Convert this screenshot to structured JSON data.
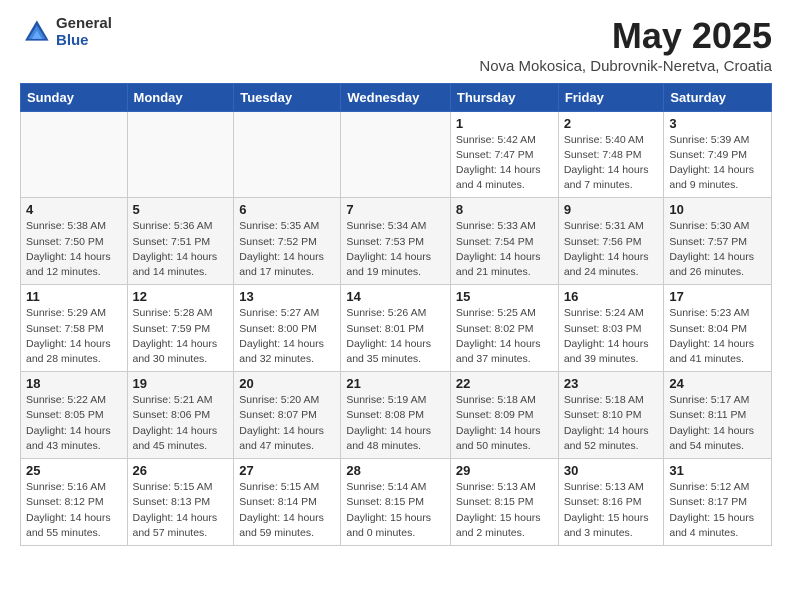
{
  "logo": {
    "general": "General",
    "blue": "Blue"
  },
  "title": "May 2025",
  "subtitle": "Nova Mokosica, Dubrovnik-Neretva, Croatia",
  "weekdays": [
    "Sunday",
    "Monday",
    "Tuesday",
    "Wednesday",
    "Thursday",
    "Friday",
    "Saturday"
  ],
  "weeks": [
    [
      {
        "day": "",
        "detail": ""
      },
      {
        "day": "",
        "detail": ""
      },
      {
        "day": "",
        "detail": ""
      },
      {
        "day": "",
        "detail": ""
      },
      {
        "day": "1",
        "detail": "Sunrise: 5:42 AM\nSunset: 7:47 PM\nDaylight: 14 hours\nand 4 minutes."
      },
      {
        "day": "2",
        "detail": "Sunrise: 5:40 AM\nSunset: 7:48 PM\nDaylight: 14 hours\nand 7 minutes."
      },
      {
        "day": "3",
        "detail": "Sunrise: 5:39 AM\nSunset: 7:49 PM\nDaylight: 14 hours\nand 9 minutes."
      }
    ],
    [
      {
        "day": "4",
        "detail": "Sunrise: 5:38 AM\nSunset: 7:50 PM\nDaylight: 14 hours\nand 12 minutes."
      },
      {
        "day": "5",
        "detail": "Sunrise: 5:36 AM\nSunset: 7:51 PM\nDaylight: 14 hours\nand 14 minutes."
      },
      {
        "day": "6",
        "detail": "Sunrise: 5:35 AM\nSunset: 7:52 PM\nDaylight: 14 hours\nand 17 minutes."
      },
      {
        "day": "7",
        "detail": "Sunrise: 5:34 AM\nSunset: 7:53 PM\nDaylight: 14 hours\nand 19 minutes."
      },
      {
        "day": "8",
        "detail": "Sunrise: 5:33 AM\nSunset: 7:54 PM\nDaylight: 14 hours\nand 21 minutes."
      },
      {
        "day": "9",
        "detail": "Sunrise: 5:31 AM\nSunset: 7:56 PM\nDaylight: 14 hours\nand 24 minutes."
      },
      {
        "day": "10",
        "detail": "Sunrise: 5:30 AM\nSunset: 7:57 PM\nDaylight: 14 hours\nand 26 minutes."
      }
    ],
    [
      {
        "day": "11",
        "detail": "Sunrise: 5:29 AM\nSunset: 7:58 PM\nDaylight: 14 hours\nand 28 minutes."
      },
      {
        "day": "12",
        "detail": "Sunrise: 5:28 AM\nSunset: 7:59 PM\nDaylight: 14 hours\nand 30 minutes."
      },
      {
        "day": "13",
        "detail": "Sunrise: 5:27 AM\nSunset: 8:00 PM\nDaylight: 14 hours\nand 32 minutes."
      },
      {
        "day": "14",
        "detail": "Sunrise: 5:26 AM\nSunset: 8:01 PM\nDaylight: 14 hours\nand 35 minutes."
      },
      {
        "day": "15",
        "detail": "Sunrise: 5:25 AM\nSunset: 8:02 PM\nDaylight: 14 hours\nand 37 minutes."
      },
      {
        "day": "16",
        "detail": "Sunrise: 5:24 AM\nSunset: 8:03 PM\nDaylight: 14 hours\nand 39 minutes."
      },
      {
        "day": "17",
        "detail": "Sunrise: 5:23 AM\nSunset: 8:04 PM\nDaylight: 14 hours\nand 41 minutes."
      }
    ],
    [
      {
        "day": "18",
        "detail": "Sunrise: 5:22 AM\nSunset: 8:05 PM\nDaylight: 14 hours\nand 43 minutes."
      },
      {
        "day": "19",
        "detail": "Sunrise: 5:21 AM\nSunset: 8:06 PM\nDaylight: 14 hours\nand 45 minutes."
      },
      {
        "day": "20",
        "detail": "Sunrise: 5:20 AM\nSunset: 8:07 PM\nDaylight: 14 hours\nand 47 minutes."
      },
      {
        "day": "21",
        "detail": "Sunrise: 5:19 AM\nSunset: 8:08 PM\nDaylight: 14 hours\nand 48 minutes."
      },
      {
        "day": "22",
        "detail": "Sunrise: 5:18 AM\nSunset: 8:09 PM\nDaylight: 14 hours\nand 50 minutes."
      },
      {
        "day": "23",
        "detail": "Sunrise: 5:18 AM\nSunset: 8:10 PM\nDaylight: 14 hours\nand 52 minutes."
      },
      {
        "day": "24",
        "detail": "Sunrise: 5:17 AM\nSunset: 8:11 PM\nDaylight: 14 hours\nand 54 minutes."
      }
    ],
    [
      {
        "day": "25",
        "detail": "Sunrise: 5:16 AM\nSunset: 8:12 PM\nDaylight: 14 hours\nand 55 minutes."
      },
      {
        "day": "26",
        "detail": "Sunrise: 5:15 AM\nSunset: 8:13 PM\nDaylight: 14 hours\nand 57 minutes."
      },
      {
        "day": "27",
        "detail": "Sunrise: 5:15 AM\nSunset: 8:14 PM\nDaylight: 14 hours\nand 59 minutes."
      },
      {
        "day": "28",
        "detail": "Sunrise: 5:14 AM\nSunset: 8:15 PM\nDaylight: 15 hours\nand 0 minutes."
      },
      {
        "day": "29",
        "detail": "Sunrise: 5:13 AM\nSunset: 8:15 PM\nDaylight: 15 hours\nand 2 minutes."
      },
      {
        "day": "30",
        "detail": "Sunrise: 5:13 AM\nSunset: 8:16 PM\nDaylight: 15 hours\nand 3 minutes."
      },
      {
        "day": "31",
        "detail": "Sunrise: 5:12 AM\nSunset: 8:17 PM\nDaylight: 15 hours\nand 4 minutes."
      }
    ]
  ]
}
